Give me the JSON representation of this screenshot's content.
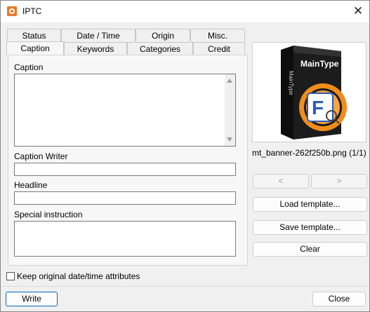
{
  "window": {
    "title": "IPTC",
    "close_glyph": "✕"
  },
  "tabs_row1": [
    "Status",
    "Date / Time",
    "Origin",
    "Misc."
  ],
  "tabs_row2": [
    "Caption",
    "Keywords",
    "Categories",
    "Credit"
  ],
  "active_tab": "Caption",
  "caption_panel": {
    "caption_label": "Caption",
    "caption_value": "",
    "caption_writer_label": "Caption Writer",
    "caption_writer_value": "",
    "headline_label": "Headline",
    "headline_value": "",
    "special_instruction_label": "Special instruction",
    "special_instruction_value": ""
  },
  "preview": {
    "box_brand": "MainType",
    "box_spine": "MainType",
    "box_letter": "F",
    "filename": "mt_banner-262f250b.png (1/1)"
  },
  "nav": {
    "prev": "<",
    "next": ">"
  },
  "buttons": {
    "load_template": "Load template...",
    "save_template": "Save template...",
    "clear": "Clear",
    "write": "Write",
    "close": "Close"
  },
  "keep_dates": {
    "label": "Keep original date/time attributes",
    "checked": false
  },
  "colors": {
    "accent": "#0067c0",
    "box_dark": "#1a1a1a",
    "box_orange": "#f08c1a"
  }
}
